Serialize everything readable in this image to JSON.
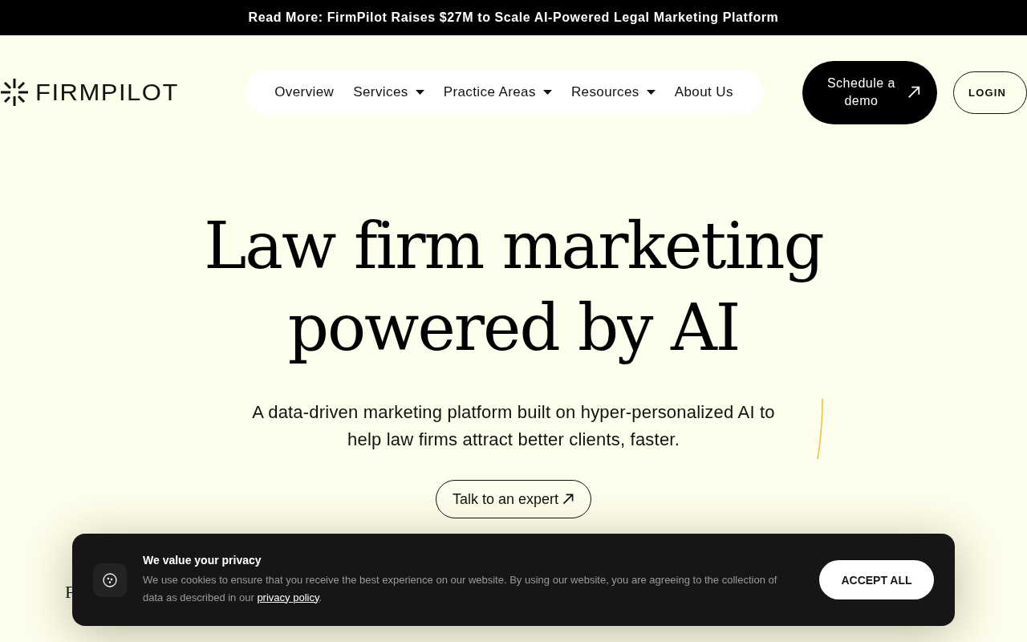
{
  "announcement": "Read More: FirmPilot Raises $27M to Scale AI-Powered Legal Marketing Platform",
  "logo": {
    "text": "FIRMPILOT"
  },
  "nav": [
    {
      "label": "Overview",
      "dropdown": false
    },
    {
      "label": "Services",
      "dropdown": true
    },
    {
      "label": "Practice Areas",
      "dropdown": true
    },
    {
      "label": "Resources",
      "dropdown": true
    },
    {
      "label": "About Us",
      "dropdown": false
    }
  ],
  "schedule_button": "Schedule a demo",
  "login_button": "LOGIN",
  "hero": {
    "title_lines": [
      "Law firm marketing",
      "powered by AI"
    ],
    "subtitle": "A data-driven marketing platform built on hyper-personalized AI to help law firms attract better clients, faster.",
    "cta": "Talk to an expert"
  },
  "below_text": "F",
  "cookie_banner": {
    "title": "We value your privacy",
    "text": "We use cookies to ensure that you receive the best experience on our website. By using our website, you are agreeing to the collection of data as described in our",
    "link": "privacy policy",
    "after_link": ".",
    "accept": "ACCEPT ALL"
  }
}
